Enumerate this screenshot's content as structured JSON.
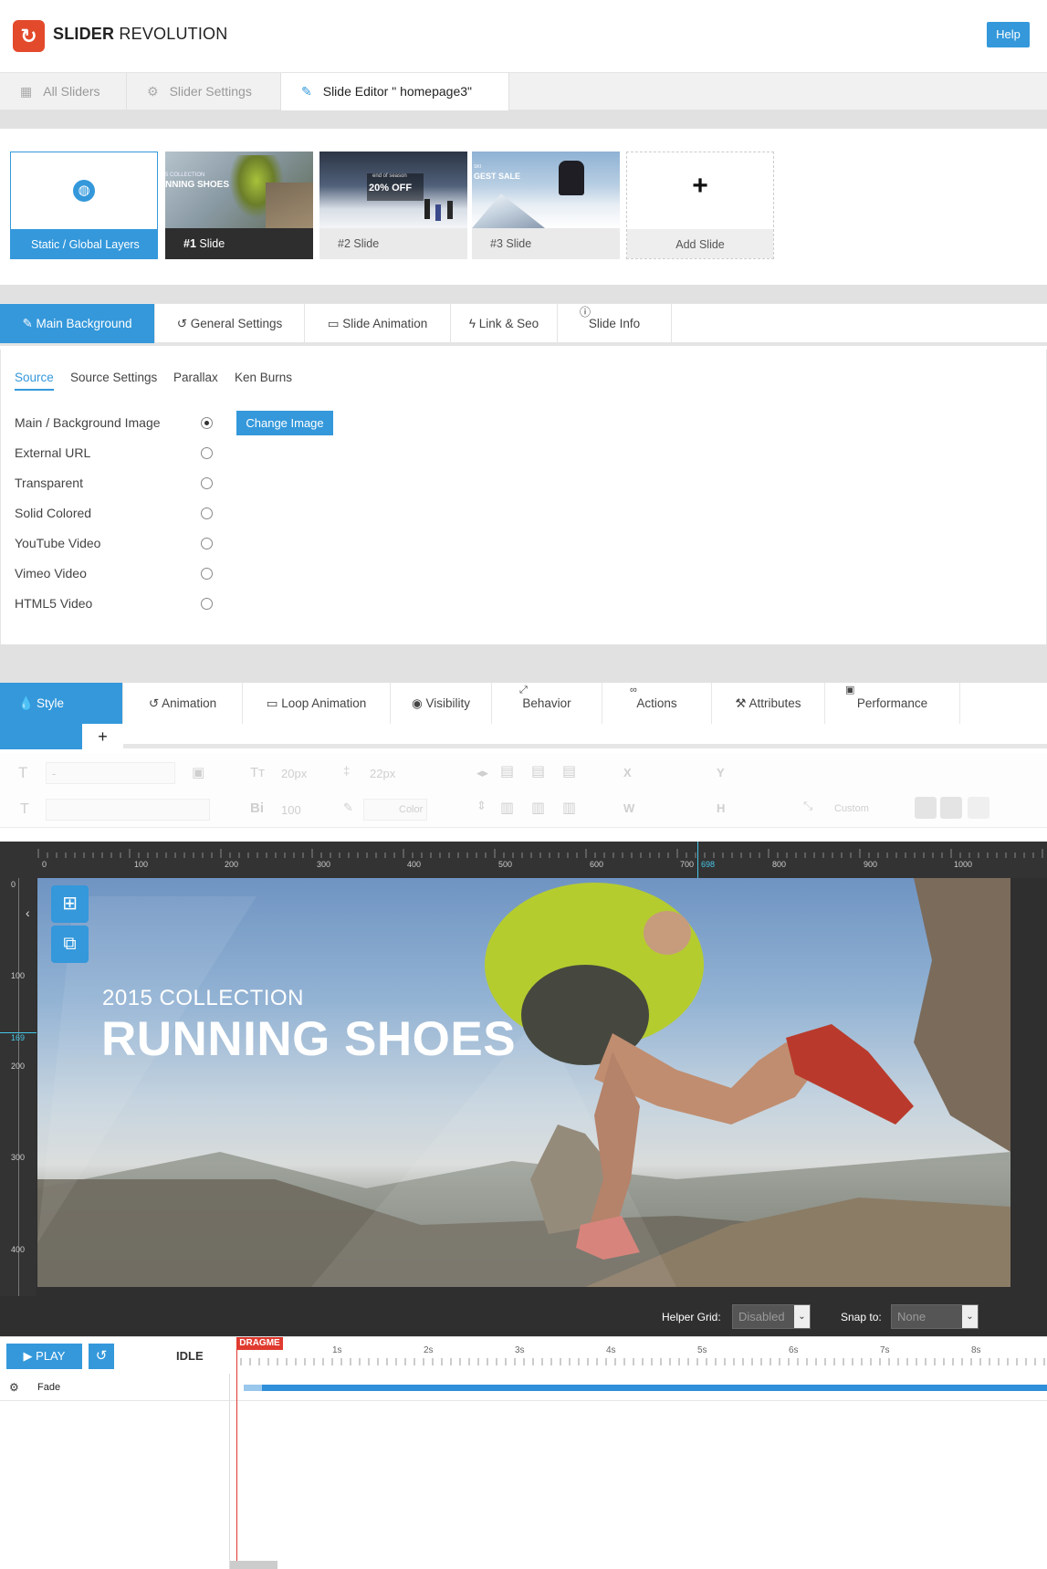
{
  "header": {
    "logo_mark": "↻",
    "logo_bold": "SLIDER",
    "logo_rest": " REVOLUTION",
    "help_label": "Help"
  },
  "top_tabs": [
    {
      "label": "All Sliders",
      "icon": "grid-icon"
    },
    {
      "label": "Slider Settings",
      "icon": "gear-icon"
    },
    {
      "label": "Slide Editor \" homepage3\"",
      "icon": "pencil-icon"
    }
  ],
  "slides": [
    {
      "label": "Static / Global Layers",
      "icon": "globe-icon"
    },
    {
      "num": "#1",
      "label": "Slide",
      "thumb_text": "NNING SHOES",
      "thumb_kicker": "5 COLLECTION"
    },
    {
      "num": "#2",
      "label": "Slide",
      "thumb_text": "20% OFF",
      "thumb_kicker": "end of season"
    },
    {
      "num": "#3",
      "label": "Slide",
      "thumb_text": "GEST SALE",
      "thumb_kicker": "SKI"
    },
    {
      "label": "Add Slide",
      "icon": "plus-icon",
      "plus": "+"
    }
  ],
  "settings_tabs": [
    {
      "label": "Main Background"
    },
    {
      "label": "General Settings"
    },
    {
      "label": "Slide Animation"
    },
    {
      "label": "Link & Seo"
    },
    {
      "label": "Slide Info"
    }
  ],
  "sub_tabs": [
    "Source",
    "Source Settings",
    "Parallax",
    "Ken Burns"
  ],
  "sources": [
    {
      "label": "Main / Background Image",
      "selected": true
    },
    {
      "label": "External URL",
      "selected": false
    },
    {
      "label": "Transparent",
      "selected": false
    },
    {
      "label": "Solid Colored",
      "selected": false
    },
    {
      "label": "YouTube Video",
      "selected": false
    },
    {
      "label": "Vimeo Video",
      "selected": false
    },
    {
      "label": "HTML5 Video",
      "selected": false
    }
  ],
  "change_image_label": "Change Image",
  "layer_tabs": [
    {
      "label": "Style"
    },
    {
      "label": "Animation"
    },
    {
      "label": "Loop Animation"
    },
    {
      "label": "Visibility"
    },
    {
      "label": "Behavior"
    },
    {
      "label": "Actions"
    },
    {
      "label": "Attributes"
    },
    {
      "label": "Performance"
    }
  ],
  "add_style": "+",
  "toolbar": {
    "font_size_ph": "20px",
    "line_height_ph": "22px",
    "weight_ph": "100",
    "color_ph": "Color",
    "x_label": "X",
    "y_label": "Y",
    "w_label": "W",
    "h_label": "H",
    "custom_ph": "Custom",
    "font_select": "-"
  },
  "ruler": {
    "h_ticks": [
      "0",
      "100",
      "200",
      "300",
      "400",
      "500",
      "600",
      "700",
      "698",
      "800",
      "900",
      "1000"
    ],
    "v_ticks": [
      "0",
      "100",
      "169",
      "200",
      "300",
      "400"
    ]
  },
  "stage": {
    "kicker": "2015 COLLECTION",
    "headline": "RUNNING SHOES"
  },
  "helper": {
    "grid_label": "Helper Grid:",
    "grid_value": "Disabled",
    "snap_label": "Snap to:",
    "snap_value": "None"
  },
  "timeline": {
    "play_label": "PLAY",
    "status": "IDLE",
    "dragme": "DRAGME",
    "seconds": [
      "1s",
      "2s",
      "3s",
      "4s",
      "5s",
      "6s",
      "7s",
      "8s"
    ],
    "layer_name": "Fade"
  },
  "colors": {
    "accent": "#3498db",
    "brand": "#e34a2b",
    "playhead": "#e03a2f"
  }
}
